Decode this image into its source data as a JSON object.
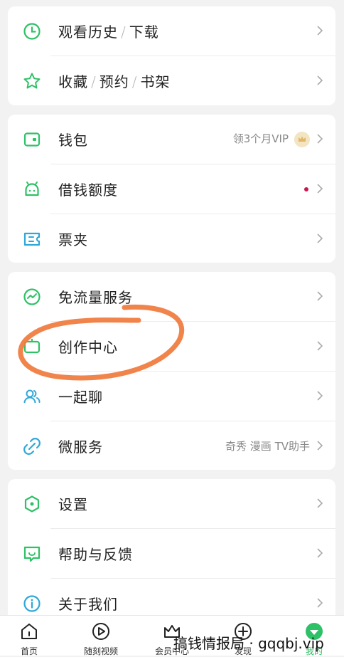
{
  "colors": {
    "accent_green": "#2fc167",
    "circle_annotation": "#f07a3c",
    "background": "#f2f2f2"
  },
  "group1": [
    {
      "name": "history",
      "icon": "clock-icon",
      "parts": [
        "观看历史",
        "下载"
      ]
    },
    {
      "name": "favorites",
      "icon": "star-icon",
      "parts": [
        "收藏",
        "预约",
        "书架"
      ]
    }
  ],
  "group2": [
    {
      "name": "wallet",
      "icon": "wallet-icon",
      "label": "钱包",
      "aux": "领3个月VIP"
    },
    {
      "name": "loan",
      "icon": "android-icon",
      "label": "借钱额度"
    },
    {
      "name": "tickets",
      "icon": "ticket-icon",
      "label": "票夹"
    }
  ],
  "group3": [
    {
      "name": "free-data",
      "icon": "trend-icon",
      "label": "免流量服务"
    },
    {
      "name": "creator",
      "icon": "creator-icon",
      "label": "创作中心"
    },
    {
      "name": "chat",
      "icon": "people-icon",
      "label": "一起聊"
    },
    {
      "name": "microservice",
      "icon": "link-icon",
      "label": "微服务",
      "aux": "奇秀 漫画 TV助手"
    }
  ],
  "group4": [
    {
      "name": "settings",
      "icon": "hexagon-icon",
      "label": "设置"
    },
    {
      "name": "help",
      "icon": "feedback-icon",
      "label": "帮助与反馈"
    },
    {
      "name": "about",
      "icon": "info-icon",
      "label": "关于我们"
    }
  ],
  "tabbar": [
    {
      "name": "home",
      "icon": "home-icon",
      "label": "首页"
    },
    {
      "name": "video",
      "icon": "play-icon",
      "label": "随刻视频"
    },
    {
      "name": "vip",
      "icon": "crown-icon",
      "label": "会员中心"
    },
    {
      "name": "discover",
      "icon": "plus-icon",
      "label": "发现"
    },
    {
      "name": "me",
      "icon": "profile-icon",
      "label": "我的"
    }
  ],
  "watermark": "搞钱情报局 · gqqbj.vip"
}
